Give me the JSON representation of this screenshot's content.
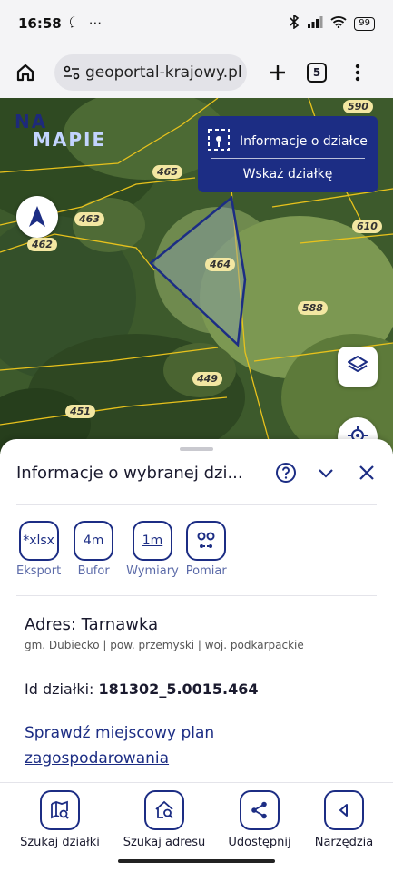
{
  "status_bar": {
    "time": "16:58",
    "battery": "99"
  },
  "browser": {
    "url": "geoportal-krajowy.pl",
    "tabs_count": "5"
  },
  "map": {
    "logo_line1": "NA",
    "logo_line2": "MAPIE",
    "parcel_labels": [
      "590",
      "588",
      "465",
      "463",
      "462",
      "610",
      "464",
      "588",
      "449",
      "451"
    ],
    "popup": {
      "info_label": "Informacje o działce",
      "show_label": "Wskaż działkę"
    }
  },
  "sheet": {
    "title": "Informacje o wybranej dzi...",
    "tools": [
      {
        "icon_text": "*xlsx",
        "label": "Eksport"
      },
      {
        "icon_text": "4m",
        "label": "Bufor"
      },
      {
        "icon_text": "1m",
        "label": "Wymiary"
      },
      {
        "icon_text": "",
        "label": "Pomiar"
      }
    ],
    "address": "Adres: Tarnawka",
    "admin": "gm. Dubiecko | pow. przemyski | woj. podkarpackie",
    "parcel_id_label": "Id działki:",
    "parcel_id_value": "181302_5.0015.464",
    "plan_link": "Sprawdź miejscowy plan zagospodarowania"
  },
  "bottom_nav": [
    {
      "label": "Szukaj działki",
      "icon": "map-search-icon"
    },
    {
      "label": "Szukaj adresu",
      "icon": "home-search-icon"
    },
    {
      "label": "Udostępnij",
      "icon": "share-icon"
    },
    {
      "label": "Narzędzia",
      "icon": "tools-icon"
    }
  ],
  "colors": {
    "accent": "#1c2d84",
    "parcel_label_bg": "#f3e7a2",
    "parcel_line": "#e8c21c"
  }
}
